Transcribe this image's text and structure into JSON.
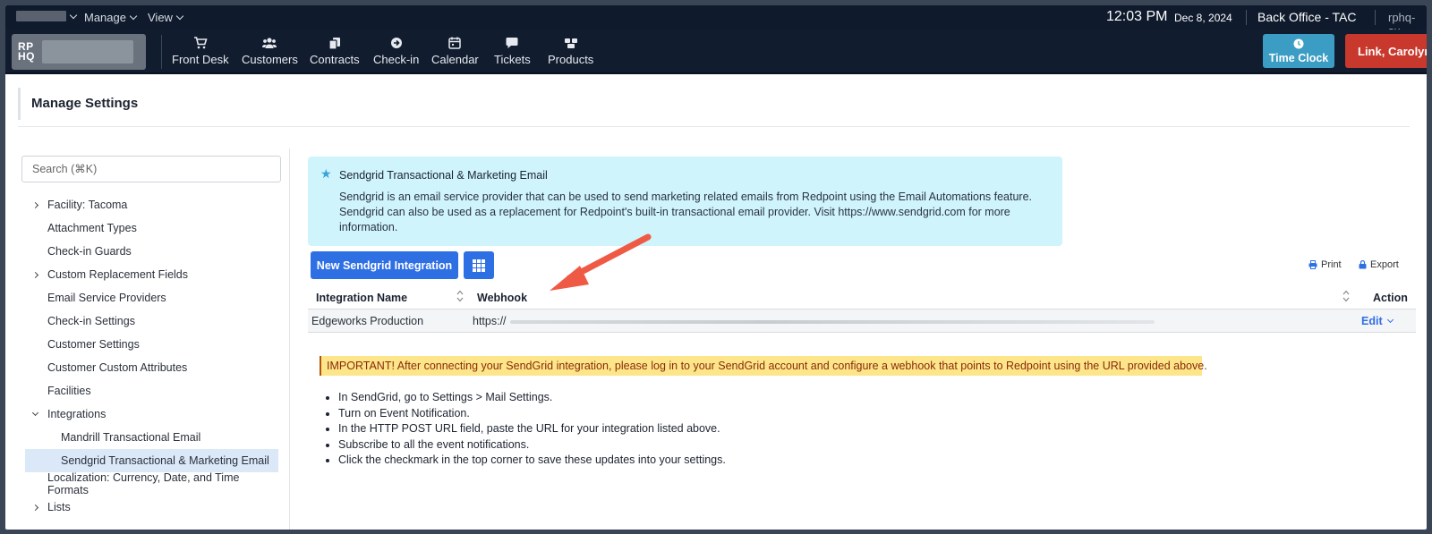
{
  "topbar": {
    "menus": [
      "Manage",
      "View"
    ],
    "time": "12:03 PM",
    "date": "Dec 8, 2024",
    "office": "Back Office - TAC",
    "site": "rphq-su"
  },
  "logo": {
    "text_line1": "RP",
    "text_line2": "HQ"
  },
  "nav": {
    "items": [
      {
        "label": "Front Desk",
        "icon": "cart-icon"
      },
      {
        "label": "Customers",
        "icon": "users-icon"
      },
      {
        "label": "Contracts",
        "icon": "copy-icon"
      },
      {
        "label": "Check-in",
        "icon": "arrow-circle-icon"
      },
      {
        "label": "Calendar",
        "icon": "calendar-icon"
      },
      {
        "label": "Tickets",
        "icon": "chat-icon"
      },
      {
        "label": "Products",
        "icon": "boxes-icon"
      }
    ],
    "time_clock": "Time Clock",
    "user": "Link, Carolyn"
  },
  "page": {
    "title": "Manage Settings"
  },
  "sidebar": {
    "search_placeholder": "Search (⌘K)",
    "items": [
      {
        "label": "Facility: Tacoma",
        "chevron": "right"
      },
      {
        "label": "Attachment Types"
      },
      {
        "label": "Check-in Guards"
      },
      {
        "label": "Custom Replacement Fields",
        "chevron": "right"
      },
      {
        "label": "Email Service Providers"
      },
      {
        "label": "Check-in Settings"
      },
      {
        "label": "Customer Settings"
      },
      {
        "label": "Customer Custom Attributes"
      },
      {
        "label": "Facilities"
      },
      {
        "label": "Integrations",
        "chevron": "down"
      },
      {
        "label": "Mandrill Transactional Email",
        "indent": true
      },
      {
        "label": "Sendgrid Transactional & Marketing Email",
        "indent": true,
        "active": true
      },
      {
        "label": "Localization: Currency, Date, and Time Formats"
      },
      {
        "label": "Lists",
        "chevron": "right"
      }
    ]
  },
  "alert": {
    "title": "Sendgrid Transactional & Marketing Email",
    "body": "Sendgrid is an email service provider that can be used to send marketing related emails from Redpoint using the Email Automations feature. Sendgrid can also be used as a replacement for Redpoint's built-in transactional email provider. Visit https://www.sendgrid.com for more information."
  },
  "toolbar": {
    "new_button": "New Sendgrid Integration",
    "print": "Print",
    "export": "Export"
  },
  "table": {
    "columns": [
      "Integration Name",
      "Webhook",
      "Action"
    ],
    "rows": [
      {
        "name": "Edgeworks Production",
        "webhook": "https://",
        "action": "Edit"
      }
    ]
  },
  "notice": {
    "important": "IMPORTANT! After connecting your SendGrid integration, please log in to your SendGrid account and configure a webhook that points to Redpoint using the URL provided above.",
    "steps": [
      "In SendGrid, go to Settings > Mail Settings.",
      "Turn on Event Notification.",
      "In the HTTP POST URL field, paste the URL for your integration listed above.",
      "Subscribe to all the event notifications.",
      "Click the checkmark in the top corner to save these updates into your settings."
    ]
  },
  "colors": {
    "topbar": "#0f1a2c",
    "primary": "#2f6fe4",
    "time_clock": "#3b9cc4",
    "user_button": "#c9382d",
    "alert_bg": "#cff4fc",
    "warning_bg": "#fde68a",
    "annotation_arrow": "#ef5a45"
  }
}
